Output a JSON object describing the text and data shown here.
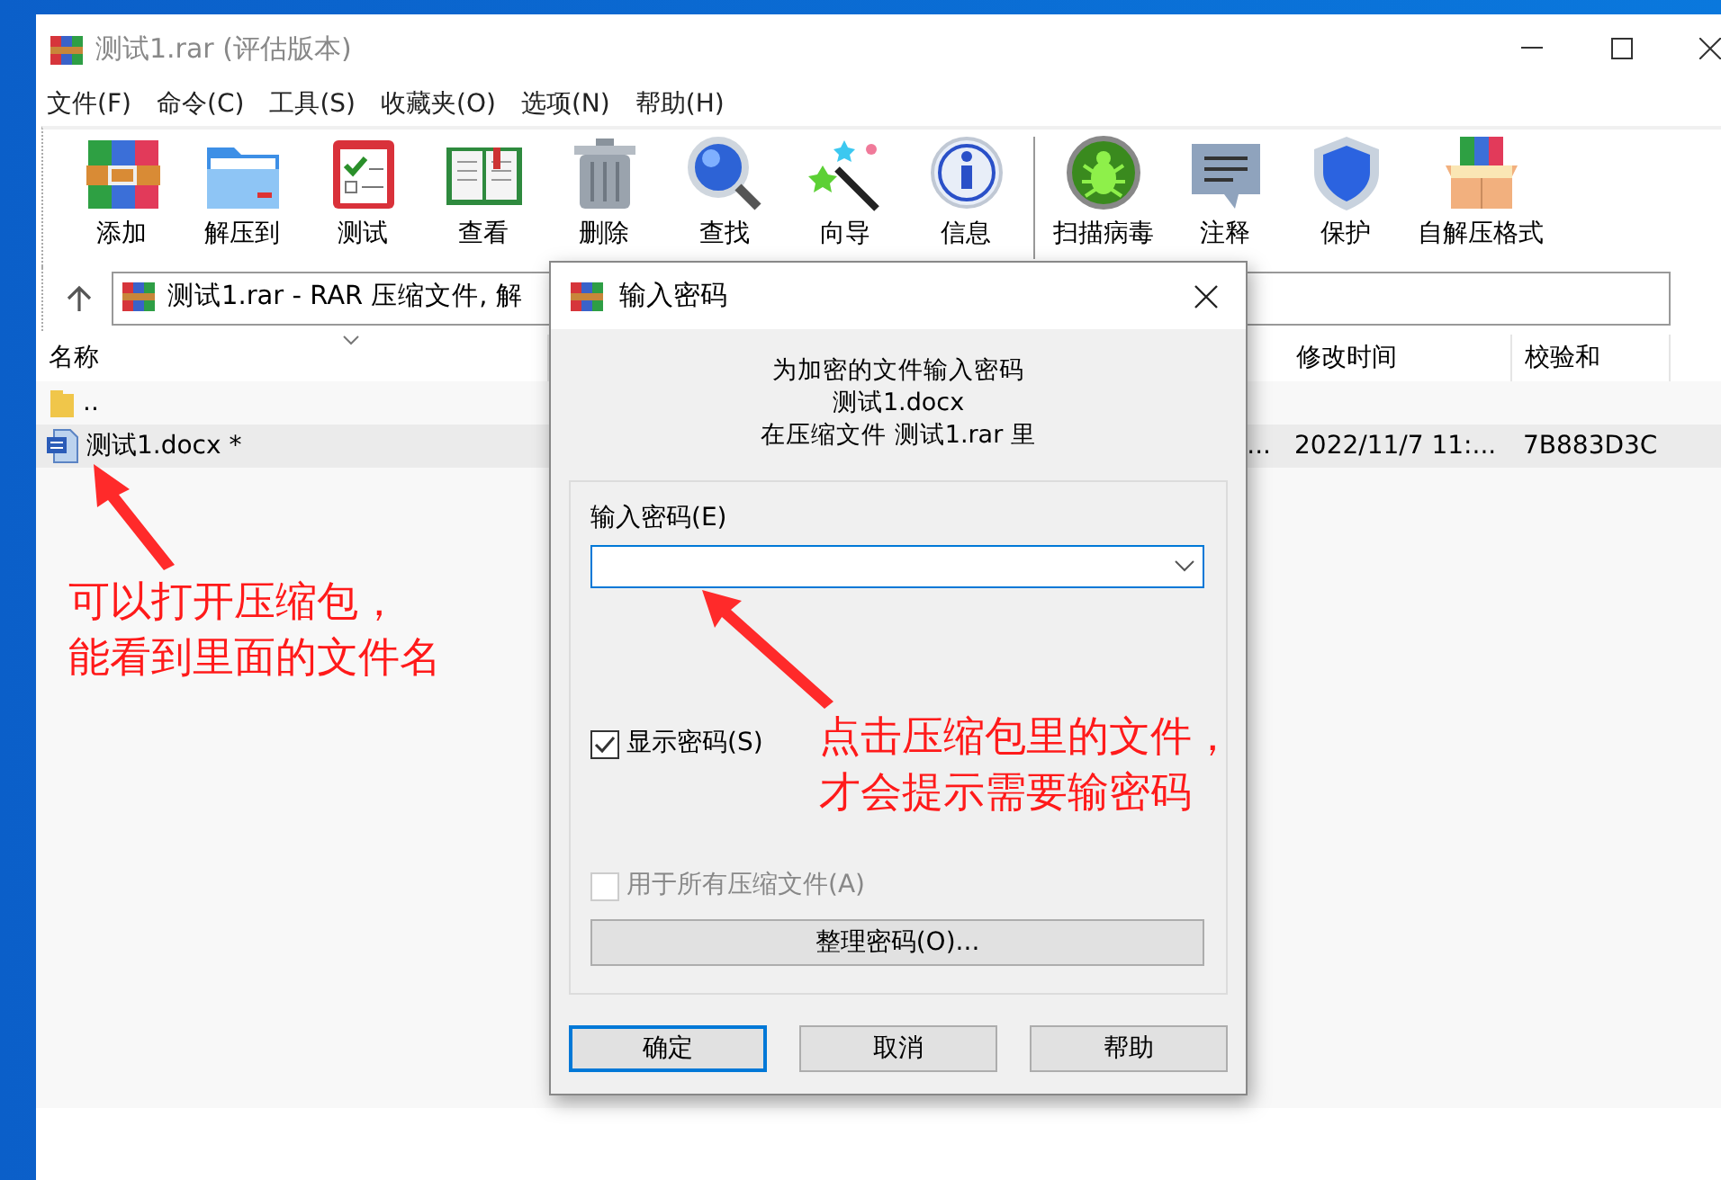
{
  "window": {
    "title": "测试1.rar (评估版本)"
  },
  "menu": [
    "文件(F)",
    "命令(C)",
    "工具(S)",
    "收藏夹(O)",
    "选项(N)",
    "帮助(H)"
  ],
  "toolbar": {
    "groups": [
      [
        {
          "label": "添加",
          "kind": "add"
        },
        {
          "label": "解压到",
          "kind": "extract"
        },
        {
          "label": "测试",
          "kind": "test"
        },
        {
          "label": "查看",
          "kind": "view"
        },
        {
          "label": "删除",
          "kind": "delete"
        },
        {
          "label": "查找",
          "kind": "find"
        },
        {
          "label": "向导",
          "kind": "wizard"
        },
        {
          "label": "信息",
          "kind": "info"
        }
      ],
      [
        {
          "label": "扫描病毒",
          "kind": "scan"
        },
        {
          "label": "注释",
          "kind": "comment"
        },
        {
          "label": "保护",
          "kind": "protect"
        },
        {
          "label": "自解压格式",
          "kind": "sfx"
        }
      ]
    ]
  },
  "address_bar": {
    "text": "测试1.rar - RAR 压缩文件, 解"
  },
  "file_list": {
    "columns": [
      {
        "label": "名称"
      },
      {
        "label": "修改时间"
      },
      {
        "label": "校验和"
      }
    ],
    "rows": [
      {
        "name": "..",
        "kind": "folder",
        "selected": false
      },
      {
        "name": "测试1.docx *",
        "kind": "document",
        "selected": true,
        "column_2": "...",
        "modified": "2022/11/7 11:...",
        "checksum": "7B883D3C"
      }
    ]
  },
  "dialog": {
    "title": "输入密码",
    "message": [
      "为加密的文件输入密码",
      "测试1.docx",
      "在压缩文件 测试1.rar 里"
    ],
    "field_label": "输入密码(E)",
    "checkboxes": [
      {
        "label": "显示密码(S)",
        "checked": true,
        "disabled": false
      },
      {
        "label": "用于所有压缩文件(A)",
        "checked": false,
        "disabled": true
      }
    ],
    "organize_button": "整理密码(O)...",
    "buttons": [
      {
        "label": "确定",
        "default": true
      },
      {
        "label": "取消",
        "default": false
      },
      {
        "label": "帮助",
        "default": false
      }
    ]
  },
  "annotations": [
    {
      "lines": [
        "可以打开压缩包，",
        "能看到里面的文件名"
      ]
    },
    {
      "lines": [
        "点击压缩包里的文件，",
        "才会提示需要输密码"
      ]
    }
  ]
}
